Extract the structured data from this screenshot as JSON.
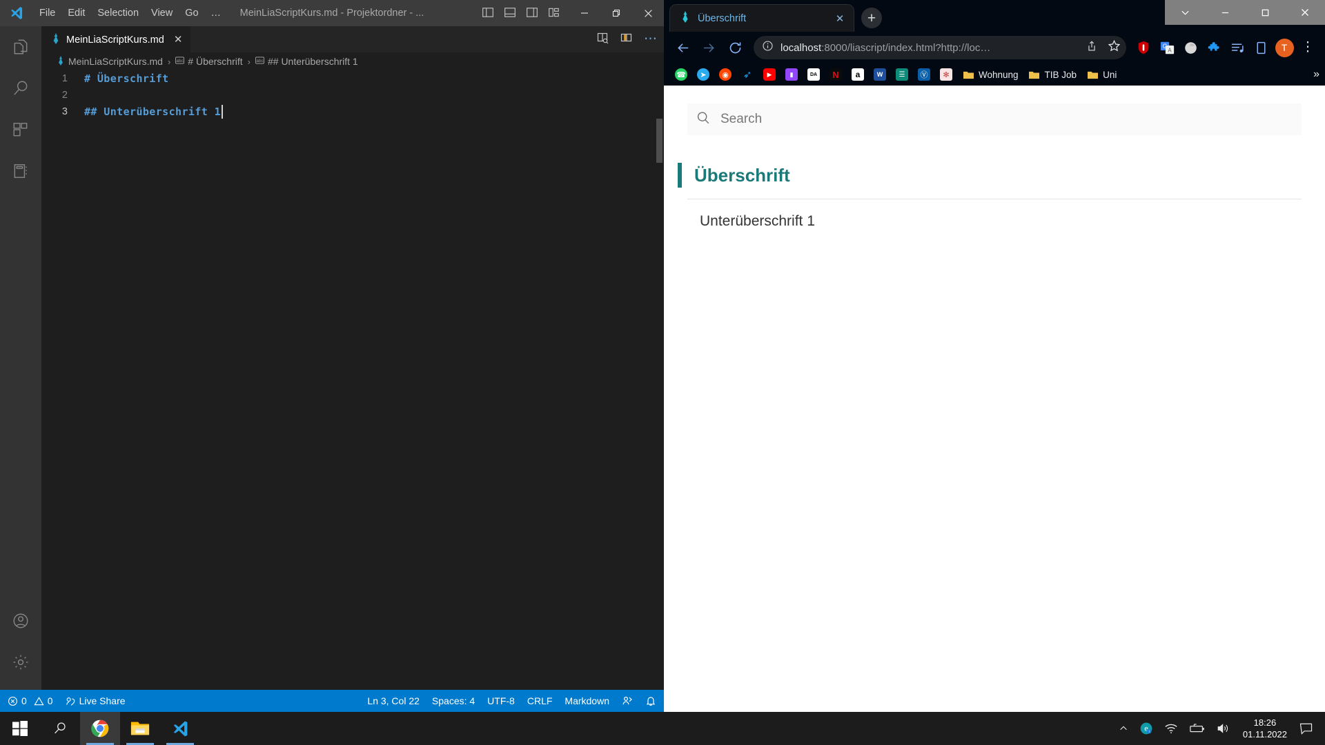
{
  "vscode": {
    "menu": [
      "File",
      "Edit",
      "Selection",
      "View",
      "Go",
      "…"
    ],
    "window_title": "MeinLiaScriptKurs.md - Projektordner - ...",
    "layout_icons": [
      "toggle-primary-sidebar-icon",
      "toggle-panel-icon",
      "toggle-secondary-sidebar-icon",
      "customize-layout-icon"
    ],
    "window_controls": [
      "minimize",
      "restore",
      "close"
    ],
    "activitybar": [
      {
        "name": "explorer",
        "label": "Explorer"
      },
      {
        "name": "search",
        "label": "Search"
      },
      {
        "name": "extensions",
        "label": "Extensions"
      },
      {
        "name": "liascript-preview",
        "label": "LiaScript Preview"
      },
      {
        "name": "accounts",
        "label": "Accounts"
      },
      {
        "name": "manage",
        "label": "Manage"
      }
    ],
    "tab": {
      "label": "MeinLiaScriptKurs.md",
      "close": "✕"
    },
    "tab_actions": [
      "open-preview-to-the-side-icon",
      "split-editor-icon",
      "more-actions-icon"
    ],
    "breadcrumb": [
      "MeinLiaScriptKurs.md",
      "# Überschrift",
      "## Unterüberschrift 1"
    ],
    "breadcrumb_separator": "›",
    "editor": {
      "lines": [
        {
          "num": "1",
          "text": "# Überschrift"
        },
        {
          "num": "2",
          "text": ""
        },
        {
          "num": "3",
          "text": "## Unterüberschrift 1"
        }
      ]
    },
    "statusbar": {
      "errors": "0",
      "warnings": "0",
      "live_share": "Live Share",
      "position": "Ln 3, Col 22",
      "spaces": "Spaces: 4",
      "encoding": "UTF-8",
      "eol": "CRLF",
      "language": "Markdown",
      "right_icons": [
        "live-share-session-icon",
        "notifications-bell-icon"
      ]
    }
  },
  "chrome": {
    "tab": {
      "title": "Überschrift",
      "close": "✕",
      "favicon": "liascript-icon"
    },
    "new_tab": "+",
    "window_controls": [
      "chevron-down",
      "–",
      "❐",
      "✕"
    ],
    "nav": {
      "back": "←",
      "forward": "→",
      "reload": "↻"
    },
    "omnibox": {
      "site_info_icon": "info-circle-icon",
      "url_host": "localhost",
      "url_rest": ":8000/liascript/index.html?http://loc…",
      "share_icon": "share-icon",
      "bookmark_icon": "star-icon"
    },
    "extensions": [
      "ublock-origin-icon",
      "google-translate-icon",
      "chrome-extension-icon",
      "puzzle-extensions-icon",
      "playlist-icon",
      "reading-list-icon"
    ],
    "avatar_letter": "T",
    "menu_icon": "⋮",
    "bookmarks": [
      {
        "name": "whatsapp",
        "label": "",
        "color": "#25D366",
        "glyph": "✆"
      },
      {
        "name": "telegram",
        "label": "",
        "color": "#2AABEE",
        "glyph": "➤"
      },
      {
        "name": "reddit",
        "label": "",
        "color": "#FF4500",
        "glyph": "◉"
      },
      {
        "name": "twitter",
        "label": "",
        "color": "#1DA1F2",
        "glyph": "✈"
      },
      {
        "name": "youtube",
        "label": "",
        "color": "#FF0000",
        "glyph": "▶"
      },
      {
        "name": "twitch",
        "label": "",
        "color": "#9146FF",
        "glyph": "▮"
      },
      {
        "name": "dazn",
        "label": "",
        "color": "#ffffff",
        "glyph": "DA"
      },
      {
        "name": "netflix",
        "label": "",
        "color": "#000000",
        "glyph": "N"
      },
      {
        "name": "amazon",
        "label": "",
        "color": "#ffffff",
        "glyph": "a"
      },
      {
        "name": "vw",
        "label": "",
        "color": "#1e3a8a",
        "glyph": "W"
      },
      {
        "name": "sparkasse",
        "label": "",
        "color": "#0d8a5c",
        "glyph": "☰"
      },
      {
        "name": "ing",
        "label": "",
        "color": "#0a5ea8",
        "glyph": "Ⓙ"
      },
      {
        "name": "stempel",
        "label": "",
        "color": "#f3dede",
        "glyph": "✻"
      },
      {
        "name": "folder-wohnung",
        "label": "Wohnung",
        "color": "#efc14b",
        "glyph": ""
      },
      {
        "name": "folder-tib-job",
        "label": "TIB Job",
        "color": "#efc14b",
        "glyph": ""
      },
      {
        "name": "folder-uni",
        "label": "Uni",
        "color": "#efc14b",
        "glyph": ""
      }
    ],
    "bookmarks_overflow": "»"
  },
  "page": {
    "search_placeholder": "Search",
    "search_icon": "search-icon",
    "h1": "Überschrift",
    "h2": "Unterüberschrift 1",
    "accent_color": "#1a7a7a"
  },
  "taskbar": {
    "start_icon": "windows-start-icon",
    "search_icon": "taskbar-search-icon",
    "apps": [
      {
        "name": "chrome",
        "active": true
      },
      {
        "name": "file-explorer",
        "active": false
      },
      {
        "name": "vscode",
        "active": false
      }
    ],
    "tray": [
      "show-hidden-icons-chevron",
      "edge-icon",
      "wifi-icon",
      "battery-icon",
      "volume-icon"
    ],
    "time": "18:26",
    "date": "01.11.2022",
    "notification_icon": "action-center-icon"
  }
}
